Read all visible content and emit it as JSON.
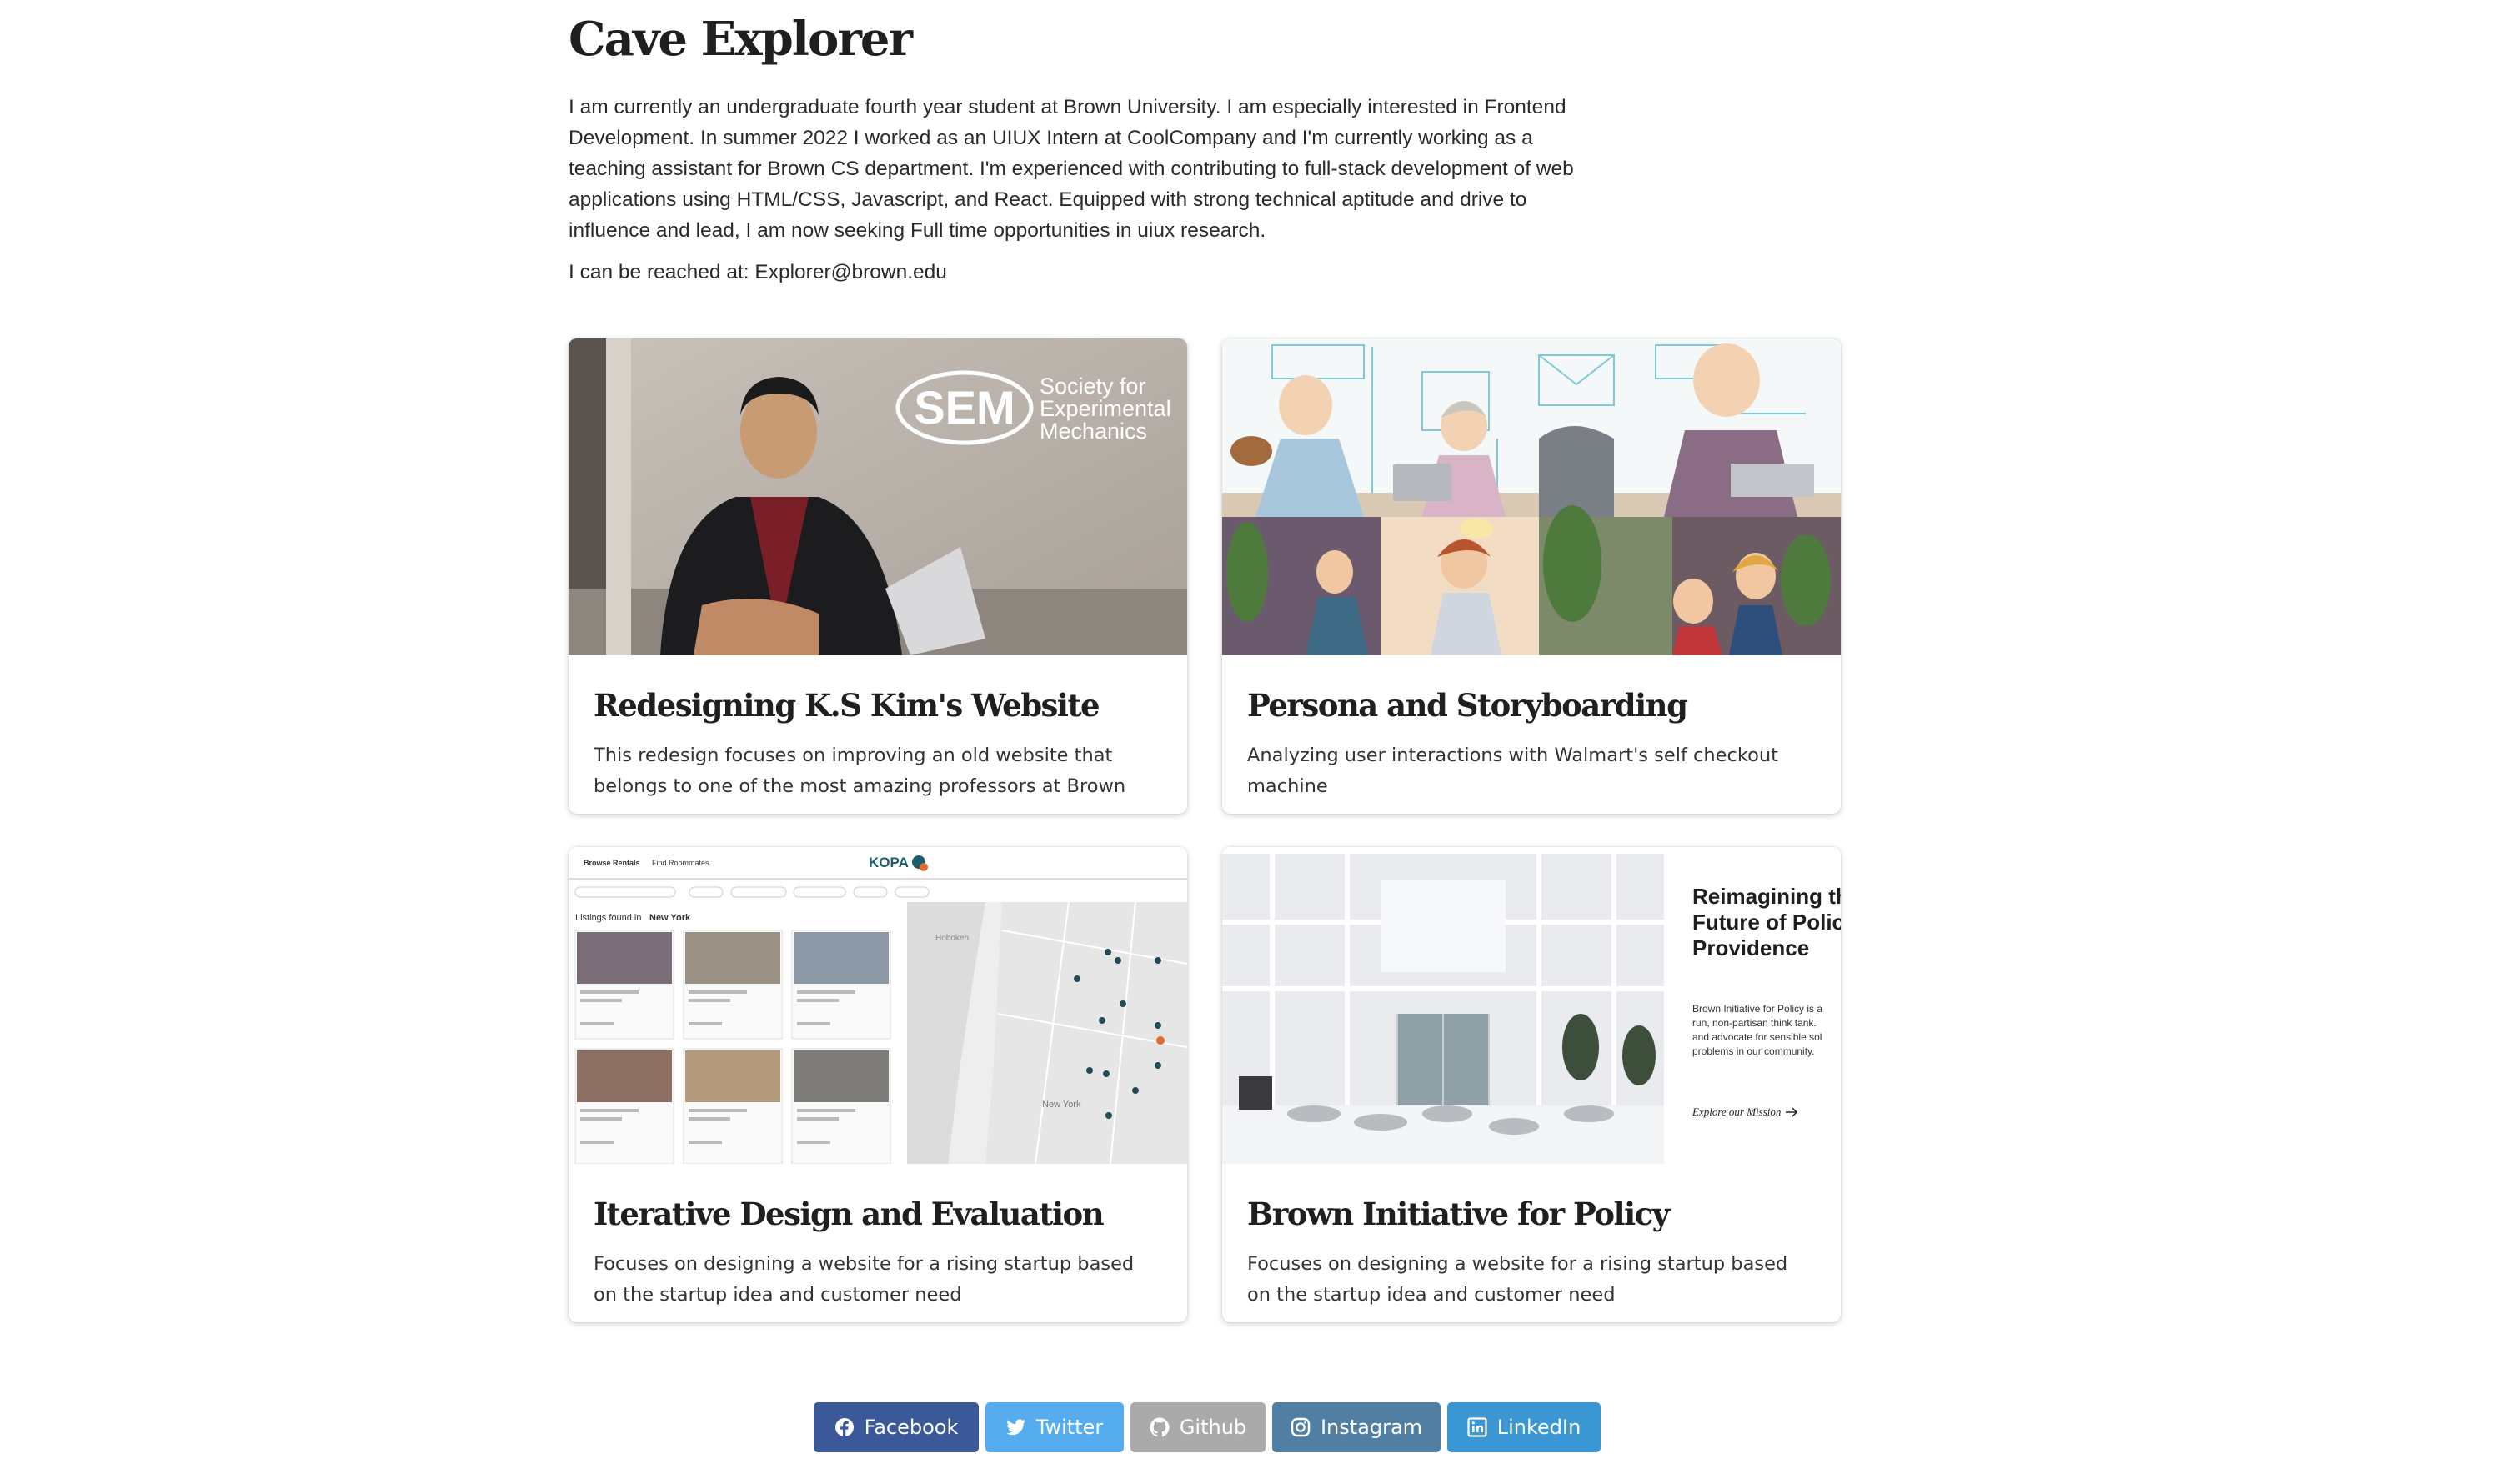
{
  "header": {
    "title": "Cave Explorer",
    "bio": "I am currently an undergraduate fourth year student at Brown University. I am especially interested in Frontend Development. In summer 2022 I worked as an UIUX Intern at CoolCompany and I'm currently working as a teaching assistant for Brown CS department. I'm experienced with contributing to full-stack development of web applications using HTML/CSS, Javascript, and React. Equipped with strong technical aptitude and drive to influence and lead, I am now seeking Full time opportunities in uiux research.",
    "contact": "I can be reached at: Explorer@brown.edu"
  },
  "projects": [
    {
      "title": "Redesigning K.S Kim's Website",
      "description": "This redesign focuses on improving an old website that belongs to one of the most amazing professors at Brown",
      "image": {
        "logo_text": "SEM",
        "caption_lines": [
          "Society for",
          "Experimental",
          "Mechanics"
        ]
      }
    },
    {
      "title": "Persona and Storyboarding",
      "description": "Analyzing user interactions with Walmart's self checkout machine"
    },
    {
      "title": "Iterative Design and Evaluation",
      "description": "Focuses on designing a website for a rising startup based on the startup idea and customer need",
      "image": {
        "brand": "KOPA",
        "nav": [
          "Browse Rentals",
          "Find Roommates"
        ],
        "listing_label": "Listings found in",
        "listing_city": "New York",
        "map_labels": [
          "Hoboken",
          "New York"
        ]
      }
    },
    {
      "title": "Brown Initiative for Policy",
      "description": "Focuses on designing a website for a rising startup based on the startup idea and customer need",
      "image": {
        "headline_lines": [
          "Reimagining th",
          "Future of Policy",
          "Providence"
        ],
        "body_lines": [
          "Brown Initiative for Policy is a",
          "run, non-partisan think tank.",
          "and advocate for sensible sol",
          "problems in our community."
        ],
        "link": "Explore our Mission"
      }
    }
  ],
  "social": [
    {
      "label": "Facebook",
      "icon": "facebook-icon",
      "color": "#3b5998"
    },
    {
      "label": "Twitter",
      "icon": "twitter-icon",
      "color": "#55acee"
    },
    {
      "label": "Github",
      "icon": "github-icon",
      "color": "#aaaaaa"
    },
    {
      "label": "Instagram",
      "icon": "instagram-icon",
      "color": "#517fa4"
    },
    {
      "label": "LinkedIn",
      "icon": "linkedin-icon",
      "color": "#3a97d4"
    }
  ]
}
